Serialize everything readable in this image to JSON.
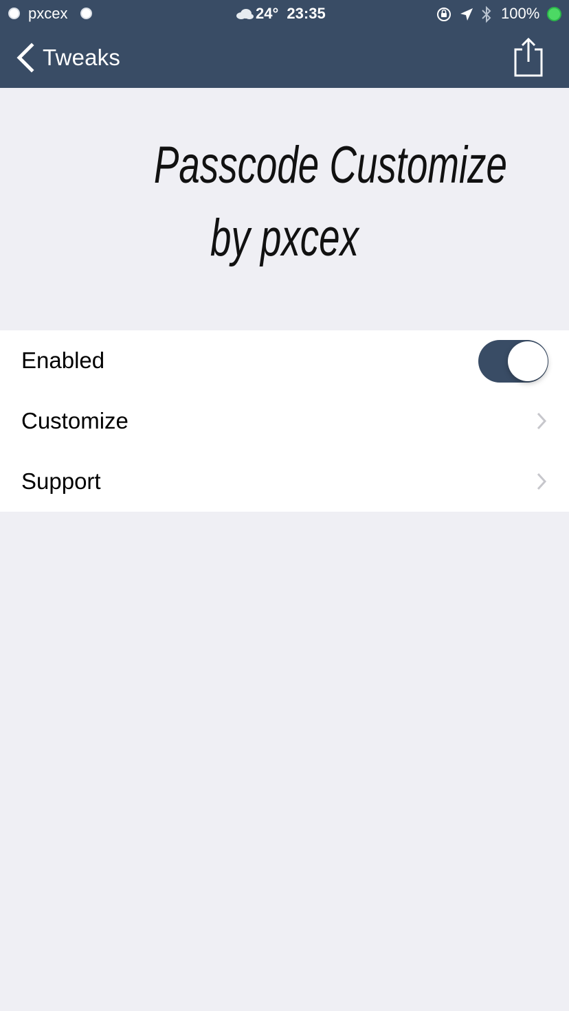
{
  "status_bar": {
    "carrier": "pxcex",
    "weather": "24°",
    "time": "23:35",
    "battery": "100%"
  },
  "nav": {
    "back_label": "Tweaks",
    "share_icon": "share-icon"
  },
  "header": {
    "line1": "Passcode Customize",
    "line2": "by pxcex"
  },
  "settings": [
    {
      "label": "Enabled",
      "type": "toggle",
      "on": true
    },
    {
      "label": "Customize",
      "type": "link"
    },
    {
      "label": "Support",
      "type": "link"
    }
  ],
  "colors": {
    "accent": "#394c65",
    "background": "#efeff4",
    "battery": "#4cd964"
  }
}
